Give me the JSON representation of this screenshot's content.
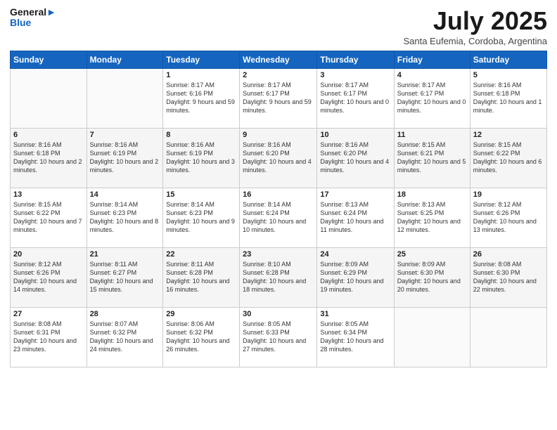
{
  "logo": {
    "line1": "General",
    "line2": "Blue"
  },
  "title": "July 2025",
  "location": "Santa Eufemia, Cordoba, Argentina",
  "days_of_week": [
    "Sunday",
    "Monday",
    "Tuesday",
    "Wednesday",
    "Thursday",
    "Friday",
    "Saturday"
  ],
  "weeks": [
    [
      {
        "day": "",
        "info": ""
      },
      {
        "day": "",
        "info": ""
      },
      {
        "day": "1",
        "info": "Sunrise: 8:17 AM\nSunset: 6:16 PM\nDaylight: 9 hours and 59 minutes."
      },
      {
        "day": "2",
        "info": "Sunrise: 8:17 AM\nSunset: 6:17 PM\nDaylight: 9 hours and 59 minutes."
      },
      {
        "day": "3",
        "info": "Sunrise: 8:17 AM\nSunset: 6:17 PM\nDaylight: 10 hours and 0 minutes."
      },
      {
        "day": "4",
        "info": "Sunrise: 8:17 AM\nSunset: 6:17 PM\nDaylight: 10 hours and 0 minutes."
      },
      {
        "day": "5",
        "info": "Sunrise: 8:16 AM\nSunset: 6:18 PM\nDaylight: 10 hours and 1 minute."
      }
    ],
    [
      {
        "day": "6",
        "info": "Sunrise: 8:16 AM\nSunset: 6:18 PM\nDaylight: 10 hours and 2 minutes."
      },
      {
        "day": "7",
        "info": "Sunrise: 8:16 AM\nSunset: 6:19 PM\nDaylight: 10 hours and 2 minutes."
      },
      {
        "day": "8",
        "info": "Sunrise: 8:16 AM\nSunset: 6:19 PM\nDaylight: 10 hours and 3 minutes."
      },
      {
        "day": "9",
        "info": "Sunrise: 8:16 AM\nSunset: 6:20 PM\nDaylight: 10 hours and 4 minutes."
      },
      {
        "day": "10",
        "info": "Sunrise: 8:16 AM\nSunset: 6:20 PM\nDaylight: 10 hours and 4 minutes."
      },
      {
        "day": "11",
        "info": "Sunrise: 8:15 AM\nSunset: 6:21 PM\nDaylight: 10 hours and 5 minutes."
      },
      {
        "day": "12",
        "info": "Sunrise: 8:15 AM\nSunset: 6:22 PM\nDaylight: 10 hours and 6 minutes."
      }
    ],
    [
      {
        "day": "13",
        "info": "Sunrise: 8:15 AM\nSunset: 6:22 PM\nDaylight: 10 hours and 7 minutes."
      },
      {
        "day": "14",
        "info": "Sunrise: 8:14 AM\nSunset: 6:23 PM\nDaylight: 10 hours and 8 minutes."
      },
      {
        "day": "15",
        "info": "Sunrise: 8:14 AM\nSunset: 6:23 PM\nDaylight: 10 hours and 9 minutes."
      },
      {
        "day": "16",
        "info": "Sunrise: 8:14 AM\nSunset: 6:24 PM\nDaylight: 10 hours and 10 minutes."
      },
      {
        "day": "17",
        "info": "Sunrise: 8:13 AM\nSunset: 6:24 PM\nDaylight: 10 hours and 11 minutes."
      },
      {
        "day": "18",
        "info": "Sunrise: 8:13 AM\nSunset: 6:25 PM\nDaylight: 10 hours and 12 minutes."
      },
      {
        "day": "19",
        "info": "Sunrise: 8:12 AM\nSunset: 6:26 PM\nDaylight: 10 hours and 13 minutes."
      }
    ],
    [
      {
        "day": "20",
        "info": "Sunrise: 8:12 AM\nSunset: 6:26 PM\nDaylight: 10 hours and 14 minutes."
      },
      {
        "day": "21",
        "info": "Sunrise: 8:11 AM\nSunset: 6:27 PM\nDaylight: 10 hours and 15 minutes."
      },
      {
        "day": "22",
        "info": "Sunrise: 8:11 AM\nSunset: 6:28 PM\nDaylight: 10 hours and 16 minutes."
      },
      {
        "day": "23",
        "info": "Sunrise: 8:10 AM\nSunset: 6:28 PM\nDaylight: 10 hours and 18 minutes."
      },
      {
        "day": "24",
        "info": "Sunrise: 8:09 AM\nSunset: 6:29 PM\nDaylight: 10 hours and 19 minutes."
      },
      {
        "day": "25",
        "info": "Sunrise: 8:09 AM\nSunset: 6:30 PM\nDaylight: 10 hours and 20 minutes."
      },
      {
        "day": "26",
        "info": "Sunrise: 8:08 AM\nSunset: 6:30 PM\nDaylight: 10 hours and 22 minutes."
      }
    ],
    [
      {
        "day": "27",
        "info": "Sunrise: 8:08 AM\nSunset: 6:31 PM\nDaylight: 10 hours and 23 minutes."
      },
      {
        "day": "28",
        "info": "Sunrise: 8:07 AM\nSunset: 6:32 PM\nDaylight: 10 hours and 24 minutes."
      },
      {
        "day": "29",
        "info": "Sunrise: 8:06 AM\nSunset: 6:32 PM\nDaylight: 10 hours and 26 minutes."
      },
      {
        "day": "30",
        "info": "Sunrise: 8:05 AM\nSunset: 6:33 PM\nDaylight: 10 hours and 27 minutes."
      },
      {
        "day": "31",
        "info": "Sunrise: 8:05 AM\nSunset: 6:34 PM\nDaylight: 10 hours and 28 minutes."
      },
      {
        "day": "",
        "info": ""
      },
      {
        "day": "",
        "info": ""
      }
    ]
  ]
}
